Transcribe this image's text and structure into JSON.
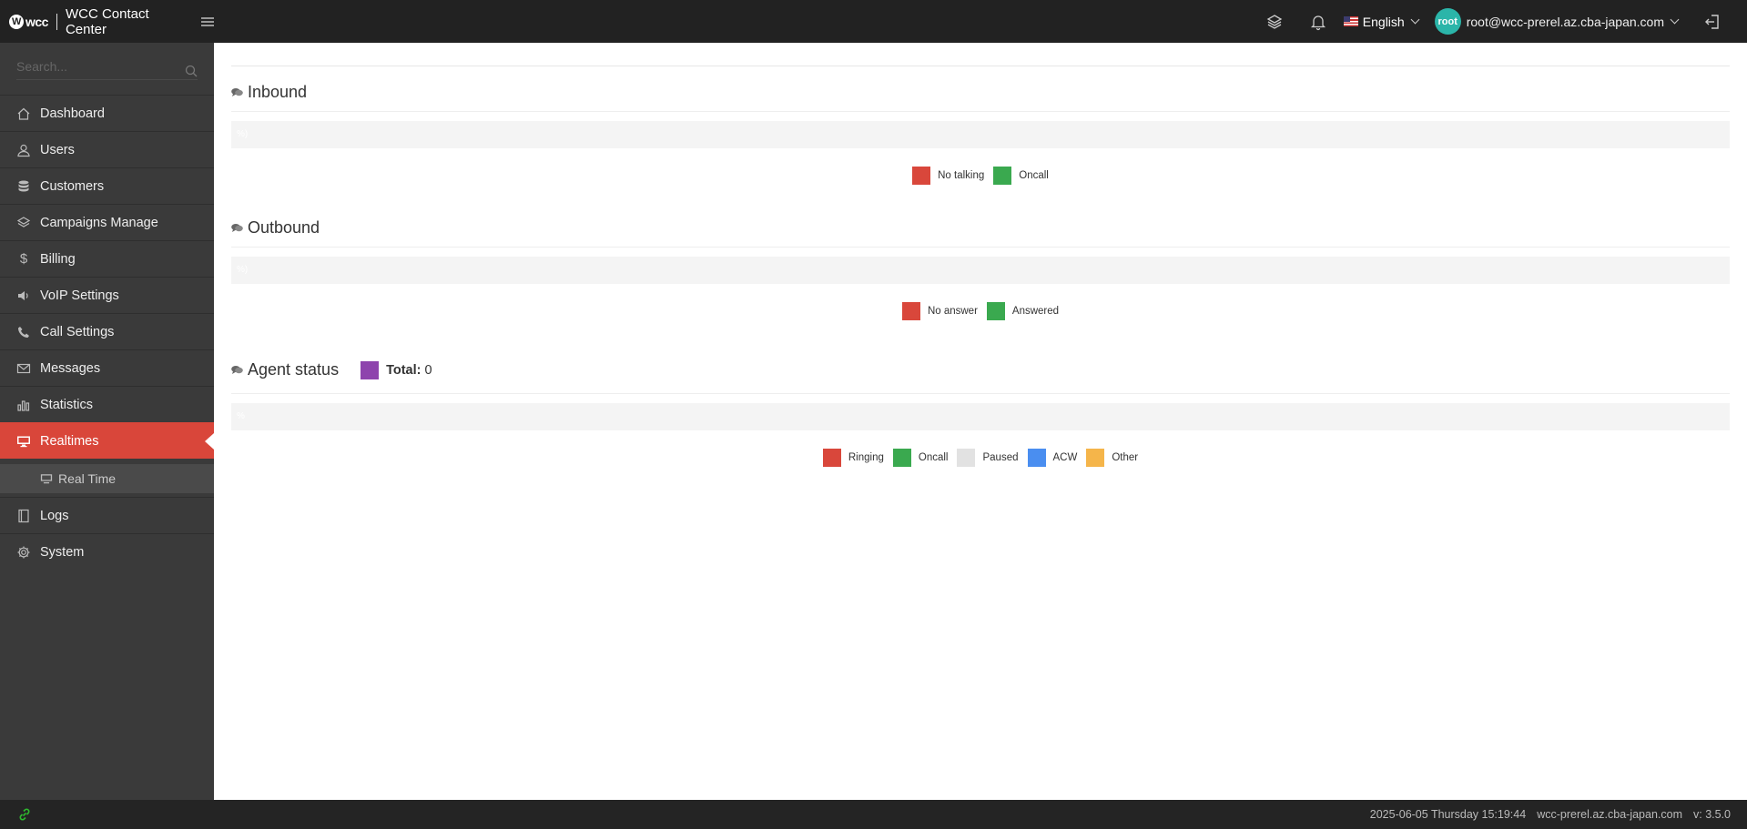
{
  "header": {
    "logo_text": "wcc",
    "app_title": "WCC Contact Center",
    "language": "English",
    "avatar_text": "root",
    "user_email": "root@wcc-prerel.az.cba-japan.com"
  },
  "sidebar": {
    "search_placeholder": "Search...",
    "items": [
      {
        "label": "Dashboard",
        "icon": "home-icon"
      },
      {
        "label": "Users",
        "icon": "user-icon"
      },
      {
        "label": "Customers",
        "icon": "database-icon"
      },
      {
        "label": "Campaigns Manage",
        "icon": "layers-icon"
      },
      {
        "label": "Billing",
        "icon": "dollar-icon"
      },
      {
        "label": "VoIP Settings",
        "icon": "speaker-icon"
      },
      {
        "label": "Call Settings",
        "icon": "phone-icon"
      },
      {
        "label": "Messages",
        "icon": "envelope-icon"
      },
      {
        "label": "Statistics",
        "icon": "bar-chart-icon"
      },
      {
        "label": "Realtimes",
        "icon": "monitor-icon"
      }
    ],
    "sub_item": {
      "label": "Real Time",
      "icon": "monitor-icon"
    },
    "items_after": [
      {
        "label": "Logs",
        "icon": "book-icon"
      },
      {
        "label": "System",
        "icon": "gear-icon"
      }
    ]
  },
  "main": {
    "inbound": {
      "title": "Inbound",
      "bar_text": "%)",
      "legend": [
        {
          "label": "No talking",
          "color": "#d9473b"
        },
        {
          "label": "Oncall",
          "color": "#3aa94f"
        }
      ]
    },
    "outbound": {
      "title": "Outbound",
      "bar_text": "%)",
      "legend": [
        {
          "label": "No answer",
          "color": "#d9473b"
        },
        {
          "label": "Answered",
          "color": "#3aa94f"
        }
      ]
    },
    "agent_status": {
      "title": "Agent status",
      "total_label": "Total:",
      "total_value": "0",
      "total_color": "#8e44ad",
      "bar_text": "%",
      "legend": [
        {
          "label": "Ringing",
          "color": "#d9473b"
        },
        {
          "label": "Oncall",
          "color": "#3aa94f"
        },
        {
          "label": "Paused",
          "color": "#e2e2e2"
        },
        {
          "label": "ACW",
          "color": "#4a8ef0"
        },
        {
          "label": "Other",
          "color": "#f5b54a"
        }
      ]
    }
  },
  "footer": {
    "datetime": "2025-06-05 Thursday 15:19:44",
    "domain": "wcc-prerel.az.cba-japan.com",
    "version": "v: 3.5.0"
  },
  "colors": {
    "active": "#d9463a",
    "sidebar": "#3a3a3a",
    "topbar": "#222222"
  }
}
